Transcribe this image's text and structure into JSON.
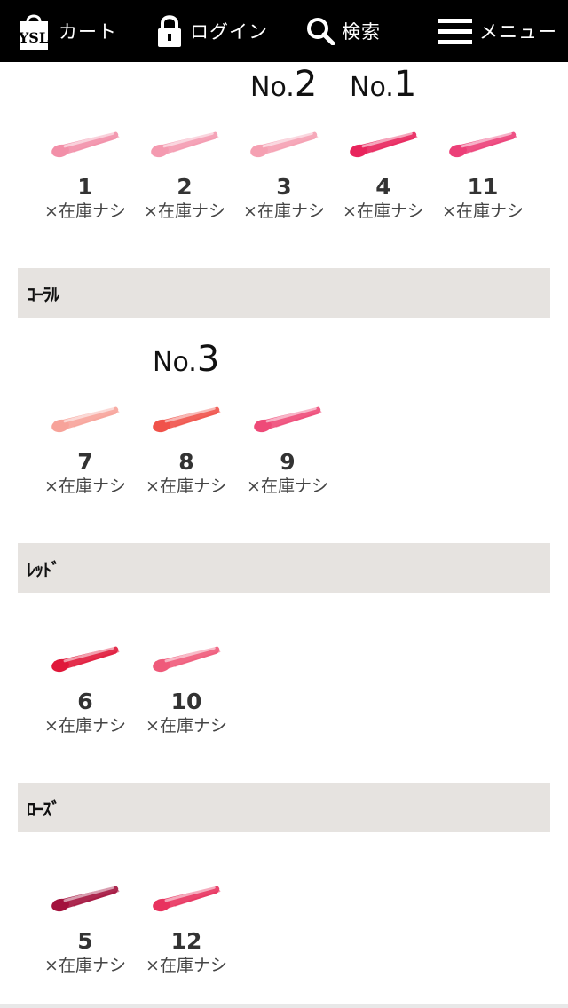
{
  "header": {
    "cart_label": "カート",
    "login_label": "ログイン",
    "search_label": "検索",
    "menu_label": "メニュー",
    "brand_logo_text": "YSL"
  },
  "ranks": [
    {
      "prefix": "No.",
      "number": "2"
    },
    {
      "prefix": "No.",
      "number": "1"
    },
    {
      "prefix": "No.",
      "number": "3"
    }
  ],
  "sections": {
    "pink": {
      "swatches": [
        {
          "number": "1",
          "stock": "×在庫ナシ",
          "color": "#f28fa8"
        },
        {
          "number": "2",
          "stock": "×在庫ナシ",
          "color": "#f49ab0"
        },
        {
          "number": "3",
          "stock": "×在庫ナシ",
          "color": "#f5a0b2"
        },
        {
          "number": "4",
          "stock": "×在庫ナシ",
          "color": "#e8245c"
        },
        {
          "number": "11",
          "stock": "×在庫ナシ",
          "color": "#ec3f78"
        }
      ]
    },
    "coral": {
      "title": "ｺｰﾗﾙ",
      "swatches": [
        {
          "number": "7",
          "stock": "×在庫ナシ",
          "color": "#f7a39a"
        },
        {
          "number": "8",
          "stock": "×在庫ナシ",
          "color": "#f0524a"
        },
        {
          "number": "9",
          "stock": "×在庫ナシ",
          "color": "#ee4a78"
        }
      ]
    },
    "red": {
      "title": "ﾚｯﾄﾞ",
      "swatches": [
        {
          "number": "6",
          "stock": "×在庫ナシ",
          "color": "#e0183a"
        },
        {
          "number": "10",
          "stock": "×在庫ナシ",
          "color": "#ef5a7a"
        }
      ]
    },
    "rose": {
      "title": "ﾛｰｽﾞ",
      "swatches": [
        {
          "number": "5",
          "stock": "×在庫ナシ",
          "color": "#a3123d"
        },
        {
          "number": "12",
          "stock": "×在庫ナシ",
          "color": "#e8325e"
        }
      ]
    }
  }
}
